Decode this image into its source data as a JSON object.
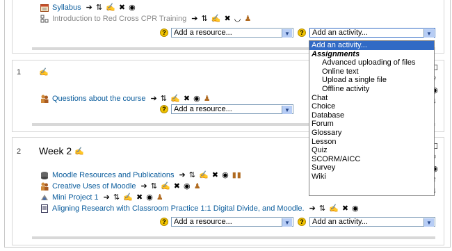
{
  "section0": {
    "items": [
      {
        "label": "Syllabus",
        "icon": "calendar-icon"
      },
      {
        "label": "Introduction to Red Cross CPR Training",
        "icon": "sitemap-icon"
      }
    ],
    "add_resource": "Add a resource...",
    "add_activity": "Add an activity..."
  },
  "section1": {
    "number": "1",
    "items": [
      {
        "label": "Questions about the course",
        "icon": "people-icon"
      }
    ],
    "add_resource": "Add a resource..."
  },
  "section2": {
    "number": "2",
    "title": "Week 2",
    "items": [
      {
        "label": "Moodle Resources and Publications",
        "icon": "database-icon"
      },
      {
        "label": "Creative Uses of Moodle",
        "icon": "people-icon"
      },
      {
        "label": "Mini Project 1",
        "icon": "workshop-icon"
      },
      {
        "label": "Aligning Research with Classroom Practice 1:1 Digital Divide, and Moodle.",
        "icon": "document-icon"
      }
    ],
    "add_resource": "Add a resource...",
    "add_activity": "Add an activity..."
  },
  "activity_menu": {
    "options": [
      {
        "label": "Add an activity...",
        "kind": "selected"
      },
      {
        "label": "Assignments",
        "kind": "group"
      },
      {
        "label": "Advanced uploading of files",
        "kind": "indent"
      },
      {
        "label": "Online text",
        "kind": "indent"
      },
      {
        "label": "Upload a single file",
        "kind": "indent"
      },
      {
        "label": "Offline activity",
        "kind": "indent"
      },
      {
        "label": "Chat",
        "kind": "plain"
      },
      {
        "label": "Choice",
        "kind": "plain"
      },
      {
        "label": "Database",
        "kind": "plain"
      },
      {
        "label": "Forum",
        "kind": "plain"
      },
      {
        "label": "Glossary",
        "kind": "plain"
      },
      {
        "label": "Lesson",
        "kind": "plain"
      },
      {
        "label": "Quiz",
        "kind": "plain"
      },
      {
        "label": "SCORM/AICC",
        "kind": "plain"
      },
      {
        "label": "Survey",
        "kind": "plain"
      },
      {
        "label": "Wiki",
        "kind": "plain"
      }
    ]
  },
  "colors": {
    "link": "#0a5c9c",
    "highlight": "#316ac5",
    "help": "#f2c400"
  }
}
